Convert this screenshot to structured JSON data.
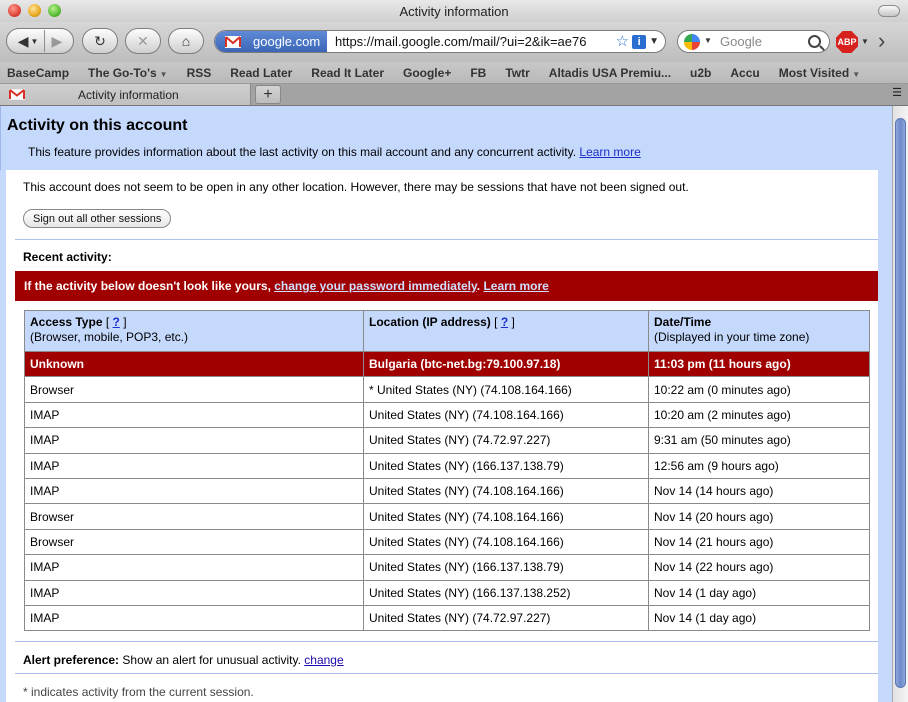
{
  "window": {
    "title": "Activity information"
  },
  "toolbar": {
    "site_identity": "google.com",
    "url": "https://mail.google.com/mail/?ui=2&ik=ae76",
    "search_placeholder": "Google",
    "abp_label": "ABP"
  },
  "bookmarks": [
    {
      "label": "BaseCamp",
      "dropdown": false
    },
    {
      "label": "The Go-To's",
      "dropdown": true
    },
    {
      "label": "RSS",
      "dropdown": false
    },
    {
      "label": "Read Later",
      "dropdown": false
    },
    {
      "label": "Read It Later",
      "dropdown": false
    },
    {
      "label": "Google+",
      "dropdown": false
    },
    {
      "label": "FB",
      "dropdown": false
    },
    {
      "label": "Twtr",
      "dropdown": false
    },
    {
      "label": "Altadis USA Premiu...",
      "dropdown": false
    },
    {
      "label": "u2b",
      "dropdown": false
    },
    {
      "label": "Accu",
      "dropdown": false
    },
    {
      "label": "Most Visited",
      "dropdown": true
    }
  ],
  "tab": {
    "title": "Activity information",
    "new_tab": "+"
  },
  "page": {
    "title": "Activity on this account",
    "description": "This feature provides information about the last activity on this mail account and any concurrent activity.",
    "learn_more": "Learn more",
    "notice": "This account does not seem to be open in any other location. However, there may be sessions that have not been signed out.",
    "signout_button": "Sign out all other sessions",
    "recent_label": "Recent activity:",
    "warning": {
      "prefix": "If the activity below doesn't look like yours, ",
      "link": "change your password immediately",
      "suffix": ". ",
      "learn_more": "Learn more"
    },
    "table": {
      "headers": [
        {
          "title": "Access Type",
          "help": "?",
          "sub": "(Browser, mobile, POP3, etc.)"
        },
        {
          "title": "Location (IP address)",
          "help": "?",
          "sub": ""
        },
        {
          "title": "Date/Time",
          "help": "",
          "sub": "(Displayed in your time zone)"
        }
      ],
      "rows": [
        {
          "type": "Unknown",
          "location": "Bulgaria (btc-net.bg:79.100.97.18)",
          "time": "11:03 pm (11 hours ago)",
          "alert": true
        },
        {
          "type": "Browser",
          "location": "* United States (NY) (74.108.164.166)",
          "time": "10:22 am (0 minutes ago)",
          "alert": false
        },
        {
          "type": "IMAP",
          "location": "United States (NY) (74.108.164.166)",
          "time": "10:20 am (2 minutes ago)",
          "alert": false
        },
        {
          "type": "IMAP",
          "location": "United States (NY) (74.72.97.227)",
          "time": "9:31 am (50 minutes ago)",
          "alert": false
        },
        {
          "type": "IMAP",
          "location": "United States (NY) (166.137.138.79)",
          "time": "12:56 am (9 hours ago)",
          "alert": false
        },
        {
          "type": "IMAP",
          "location": "United States (NY) (74.108.164.166)",
          "time": "Nov 14 (14 hours ago)",
          "alert": false
        },
        {
          "type": "Browser",
          "location": "United States (NY) (74.108.164.166)",
          "time": "Nov 14 (20 hours ago)",
          "alert": false
        },
        {
          "type": "Browser",
          "location": "United States (NY) (74.108.164.166)",
          "time": "Nov 14 (21 hours ago)",
          "alert": false
        },
        {
          "type": "IMAP",
          "location": "United States (NY) (166.137.138.79)",
          "time": "Nov 14 (22 hours ago)",
          "alert": false
        },
        {
          "type": "IMAP",
          "location": "United States (NY) (166.137.138.252)",
          "time": "Nov 14 (1 day ago)",
          "alert": false
        },
        {
          "type": "IMAP",
          "location": "United States (NY) (74.72.97.227)",
          "time": "Nov 14 (1 day ago)",
          "alert": false
        }
      ]
    },
    "alert_pref": {
      "label": "Alert preference:",
      "text": "Show an alert for unusual activity.",
      "link": "change"
    },
    "footnote": "* indicates activity from the current session."
  },
  "colors": {
    "header_band": "#c5d9fd",
    "alert_red": "#a00000",
    "link_blue": "#1a2fcc"
  }
}
